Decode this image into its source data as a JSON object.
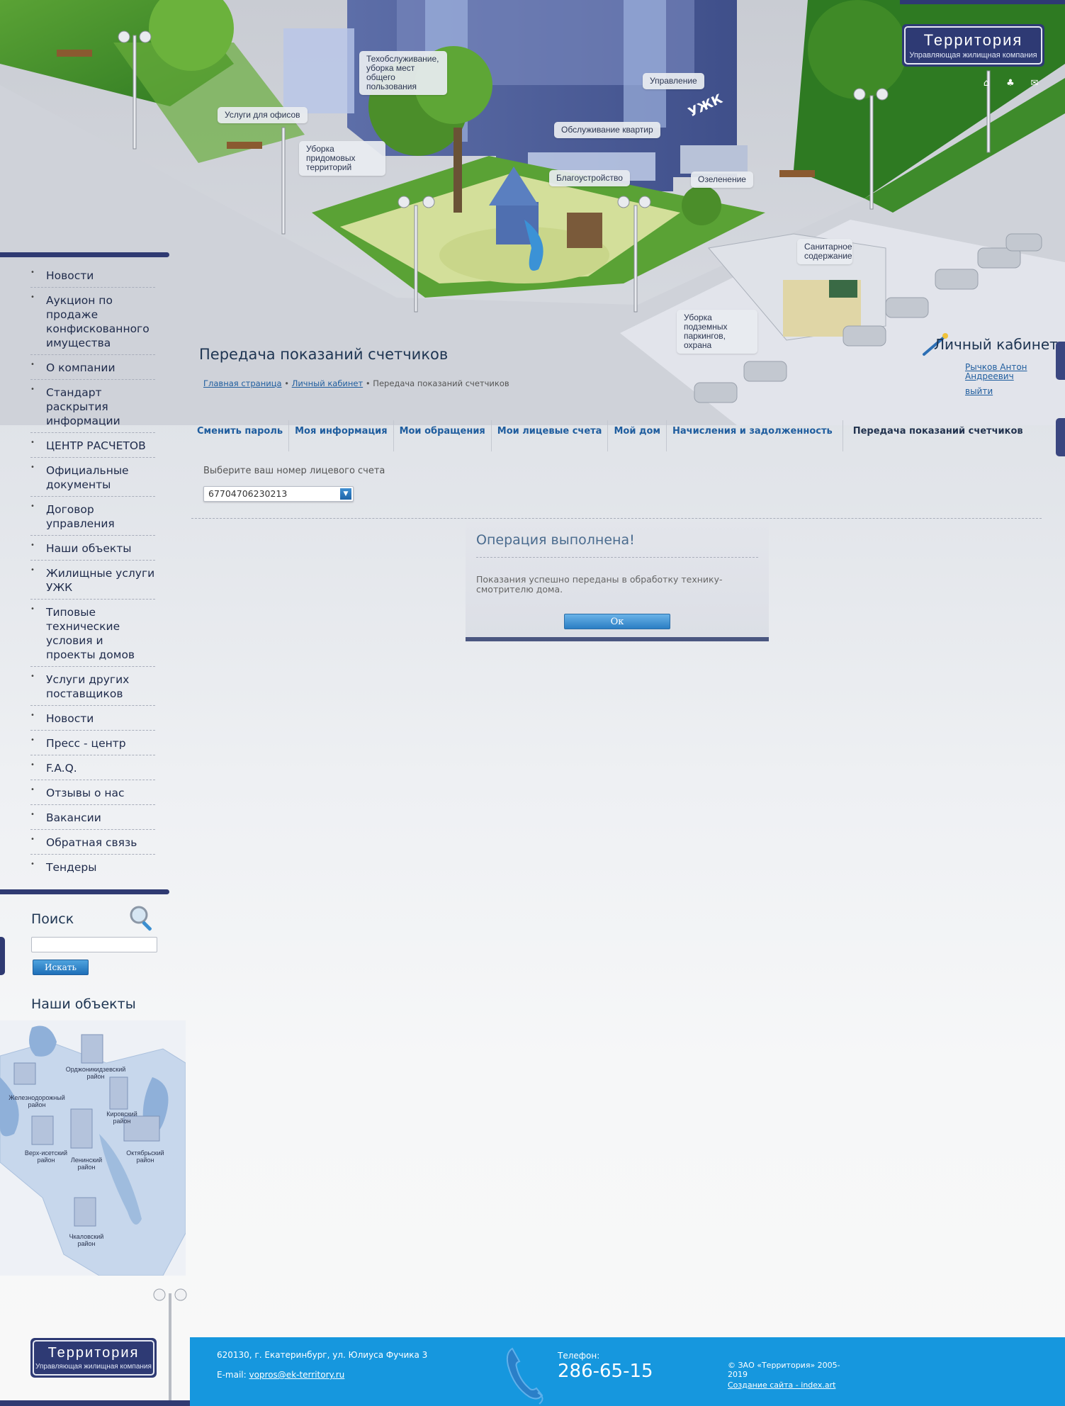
{
  "logo": {
    "name": "Территория",
    "subtitle": "Управляющая жилищная компания"
  },
  "scene_callouts": [
    "Техобслуживание, уборка мест общего пользования",
    "Управление",
    "Услуги для офисов",
    "Обслуживание квартир",
    "Уборка придомовых территорий",
    "Благоустройство",
    "Озеленение",
    "Санитарное содержание",
    "Уборка подземных паркингов, охрана"
  ],
  "top_icons": [
    "home-icon",
    "sitemap-icon",
    "mail-icon"
  ],
  "nav": [
    "Новости",
    "Аукцион по продаже конфискованного имущества",
    "О компании",
    "Стандарт раскрытия информации",
    "ЦЕНТР РАСЧЕТОВ",
    "Официальные документы",
    "Договор управления",
    "Наши объекты",
    "Жилищные услуги УЖК",
    "Типовые технические условия и проекты домов",
    "Услуги других поставщиков",
    "Новости",
    "Пресс - центр",
    "F.A.Q.",
    "Отзывы о нас",
    "Вакансии",
    "Обратная связь",
    "Тендеры"
  ],
  "search": {
    "title": "Поиск",
    "button": "Искать",
    "value": ""
  },
  "objects": {
    "title": "Наши объекты",
    "districts": [
      "Орджоникидзевский район",
      "Железнодорожный район",
      "Кировский район",
      "Верх-исетский район",
      "Ленинский район",
      "Октябрьский район",
      "Чкаловский район"
    ]
  },
  "page": {
    "title": "Передача показаний счетчиков",
    "breadcrumb": {
      "home": "Главная страница",
      "sep1": " • ",
      "cabinet": "Личный кабинет",
      "sep2": " • ",
      "current": "Передача показаний счетчиков"
    }
  },
  "cabinet": {
    "title": "Личный кабинет",
    "user": "Рычков Антон Андреевич",
    "logout": "выйти"
  },
  "tabs": [
    {
      "label": "Сменить пароль",
      "active": false
    },
    {
      "label": "Моя информация",
      "active": false
    },
    {
      "label": "Мои обращения",
      "active": false
    },
    {
      "label": "Мои лицевые счета",
      "active": false
    },
    {
      "label": "Мой дом",
      "active": false
    },
    {
      "label": "Начисления и задолженность",
      "active": false
    },
    {
      "label": "Передача показаний счетчиков",
      "active": true
    }
  ],
  "account": {
    "label": "Выберите ваш номер лицевого счета",
    "selected": "67704706230213"
  },
  "dialog": {
    "title": "Операция выполнена!",
    "text": "Показания успешно переданы в обработку технику-смотрителю дома.",
    "ok": "Ок"
  },
  "footer": {
    "address": "620130, г. Екатеринбург, ул. Юлиуса Фучика 3",
    "email_label": "E-mail: ",
    "email": "vopros@ek-territory.ru",
    "phone_label": "Телефон:",
    "phone": "286-65-15",
    "copyright": "© ЗАО «Территория» 2005-2019",
    "made_by": "Создание сайта - index.art"
  },
  "colors": {
    "brand_navy": "#2e3a74",
    "link": "#1f5d9e",
    "footer_blue": "#1697de",
    "grass": "#5aa235"
  }
}
